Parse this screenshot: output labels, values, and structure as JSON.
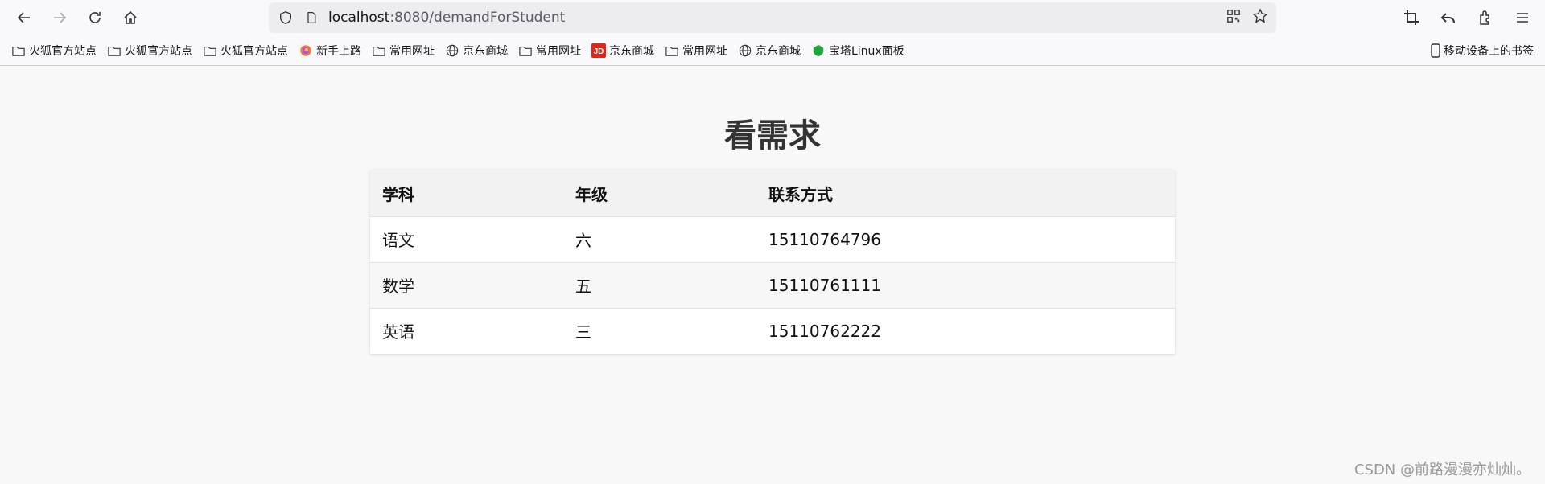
{
  "browser": {
    "url_host": "localhost",
    "url_rest": ":8080/demandForStudent",
    "bookmarks": [
      {
        "label": "火狐官方站点",
        "icon": "folder-icon"
      },
      {
        "label": "火狐官方站点",
        "icon": "folder-icon"
      },
      {
        "label": "火狐官方站点",
        "icon": "folder-icon"
      },
      {
        "label": "新手上路",
        "icon": "firefox-icon"
      },
      {
        "label": "常用网址",
        "icon": "folder-icon"
      },
      {
        "label": "京东商城",
        "icon": "globe-icon"
      },
      {
        "label": "常用网址",
        "icon": "folder-icon"
      },
      {
        "label": "京东商城",
        "icon": "jd-icon"
      },
      {
        "label": "常用网址",
        "icon": "folder-icon"
      },
      {
        "label": "京东商城",
        "icon": "globe-icon"
      },
      {
        "label": "宝塔Linux面板",
        "icon": "baota-icon"
      }
    ],
    "mobile_bookmarks": "移动设备上的书签"
  },
  "page": {
    "title": "看需求",
    "table": {
      "headers": [
        "学科",
        "年级",
        "联系方式"
      ],
      "rows": [
        [
          "语文",
          "六",
          "15110764796"
        ],
        [
          "数学",
          "五",
          "15110761111"
        ],
        [
          "英语",
          "三",
          "15110762222"
        ]
      ]
    }
  },
  "watermark": "CSDN @前路漫漫亦灿灿。",
  "colors": {
    "jd_red": "#e1251b",
    "baota_green": "#20a53a"
  }
}
